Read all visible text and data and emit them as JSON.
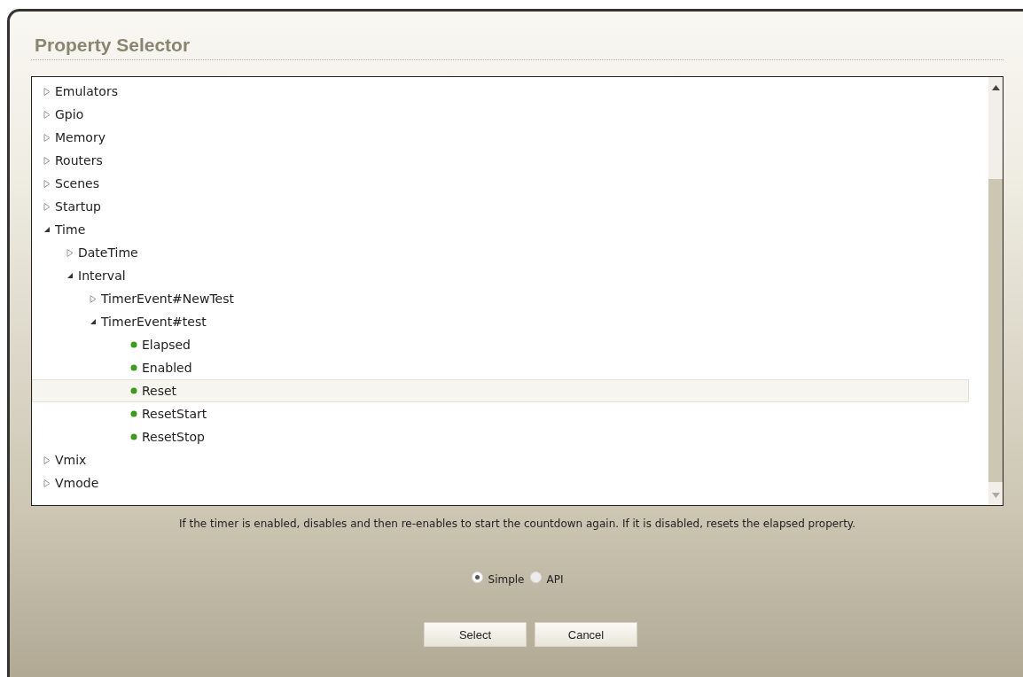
{
  "title": "Property Selector",
  "tree": [
    {
      "label": "Emulators",
      "kind": "folder",
      "expanded": false,
      "selected": false
    },
    {
      "label": "Gpio",
      "kind": "folder",
      "expanded": false,
      "selected": false
    },
    {
      "label": "Memory",
      "kind": "folder",
      "expanded": false,
      "selected": false
    },
    {
      "label": "Routers",
      "kind": "folder",
      "expanded": false,
      "selected": false
    },
    {
      "label": "Scenes",
      "kind": "folder",
      "expanded": false,
      "selected": false
    },
    {
      "label": "Startup",
      "kind": "folder",
      "expanded": false,
      "selected": false
    },
    {
      "label": "Time",
      "kind": "folder",
      "expanded": true,
      "selected": false,
      "children": [
        {
          "label": "DateTime",
          "kind": "folder",
          "expanded": false,
          "selected": false
        },
        {
          "label": "Interval",
          "kind": "folder",
          "expanded": true,
          "selected": false,
          "children": [
            {
              "label": "TimerEvent#NewTest",
              "kind": "folder",
              "expanded": false,
              "selected": false
            },
            {
              "label": "TimerEvent#test",
              "kind": "folder",
              "expanded": true,
              "selected": false,
              "children": [
                {
                  "label": "Elapsed",
                  "kind": "property",
                  "selected": false
                },
                {
                  "label": "Enabled",
                  "kind": "property",
                  "selected": false
                },
                {
                  "label": "Reset",
                  "kind": "property",
                  "selected": true
                },
                {
                  "label": "ResetStart",
                  "kind": "property",
                  "selected": false
                },
                {
                  "label": "ResetStop",
                  "kind": "property",
                  "selected": false
                }
              ]
            }
          ]
        }
      ]
    },
    {
      "label": "Vmix",
      "kind": "folder",
      "expanded": false,
      "selected": false
    },
    {
      "label": "Vmode",
      "kind": "folder",
      "expanded": false,
      "selected": false
    }
  ],
  "description": "If the timer is enabled, disables and then re-enables to start the countdown again. If it is disabled, resets the elapsed property.",
  "modes": [
    {
      "label": "Simple",
      "selected": true
    },
    {
      "label": "API",
      "selected": false
    }
  ],
  "buttons": [
    "Select",
    "Cancel"
  ]
}
